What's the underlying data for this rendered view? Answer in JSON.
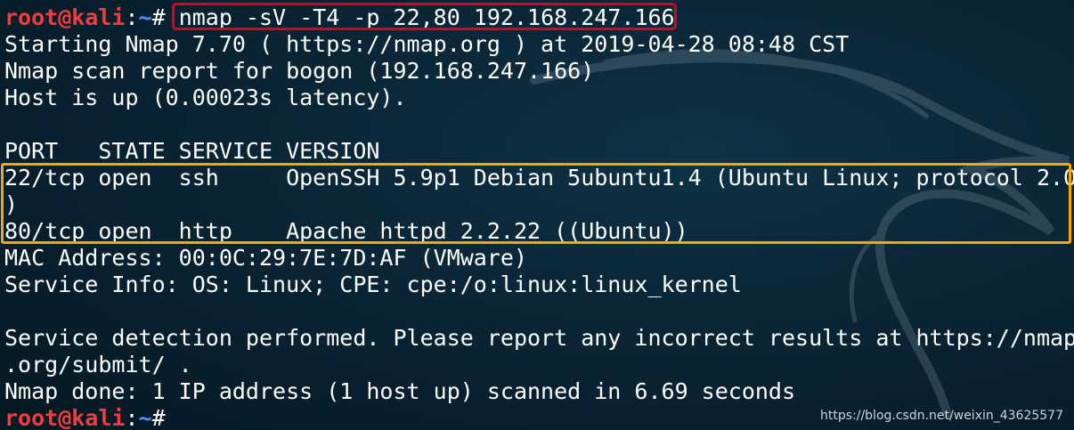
{
  "prompt": {
    "user": "root@kali",
    "sep": ":",
    "path": "~",
    "symbol": "# "
  },
  "command": "nmap -sV -T4 -p 22,80 192.168.247.166",
  "output": [
    "Starting Nmap 7.70 ( https://nmap.org ) at 2019-04-28 08:48 CST",
    "Nmap scan report for bogon (192.168.247.166)",
    "Host is up (0.00023s latency).",
    "",
    "PORT   STATE SERVICE VERSION",
    "22/tcp open  ssh     OpenSSH 5.9p1 Debian 5ubuntu1.4 (Ubuntu Linux; protocol 2.0",
    ")",
    "80/tcp open  http    Apache httpd 2.2.22 ((Ubuntu))",
    "MAC Address: 00:0C:29:7E:7D:AF (VMware)",
    "Service Info: OS: Linux; CPE: cpe:/o:linux:linux_kernel",
    "",
    "Service detection performed. Please report any incorrect results at https://nmap",
    ".org/submit/ .",
    "Nmap done: 1 IP address (1 host up) scanned in 6.69 seconds"
  ],
  "watermark": "https://blog.csdn.net/weixin_43625577",
  "colors": {
    "background": "#081e2c",
    "prompt_user": "#f03c3c",
    "prompt_path": "#4d8fff",
    "command_highlight": "#e0001a",
    "ports_highlight": "#f5a800"
  }
}
